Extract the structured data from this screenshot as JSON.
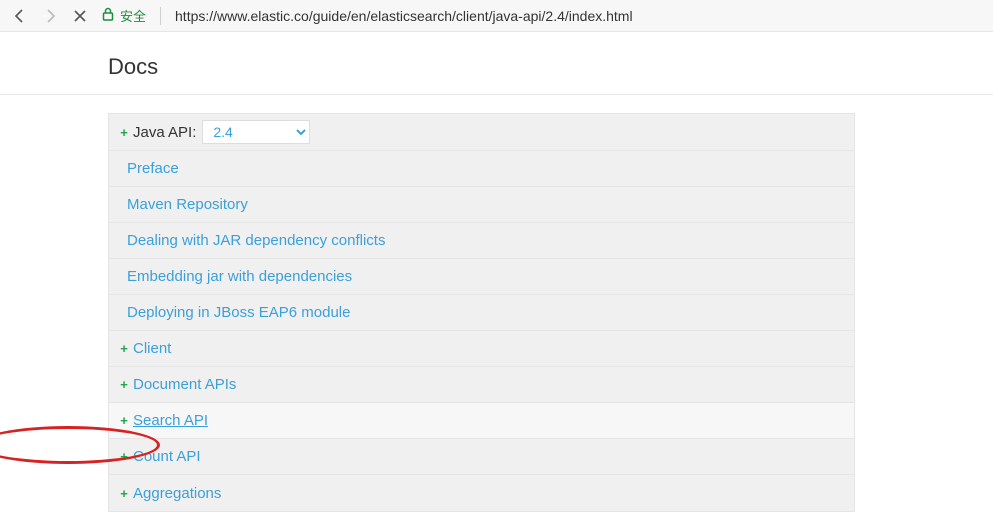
{
  "browser": {
    "secure_label": "安全",
    "url": "https://www.elastic.co/guide/en/elasticsearch/client/java-api/2.4/index.html"
  },
  "docs": {
    "title": "Docs"
  },
  "nav": {
    "root_label": "Java API:",
    "version_selected": "2.4",
    "items": [
      {
        "label": "Preface"
      },
      {
        "label": "Maven Repository"
      },
      {
        "label": "Dealing with JAR dependency conflicts"
      },
      {
        "label": "Embedding jar with dependencies"
      },
      {
        "label": "Deploying in JBoss EAP6 module"
      }
    ],
    "expandables": [
      {
        "label": "Client"
      },
      {
        "label": "Document APIs"
      },
      {
        "label": "Search API"
      },
      {
        "label": "Count API"
      },
      {
        "label": "Aggregations"
      }
    ]
  }
}
